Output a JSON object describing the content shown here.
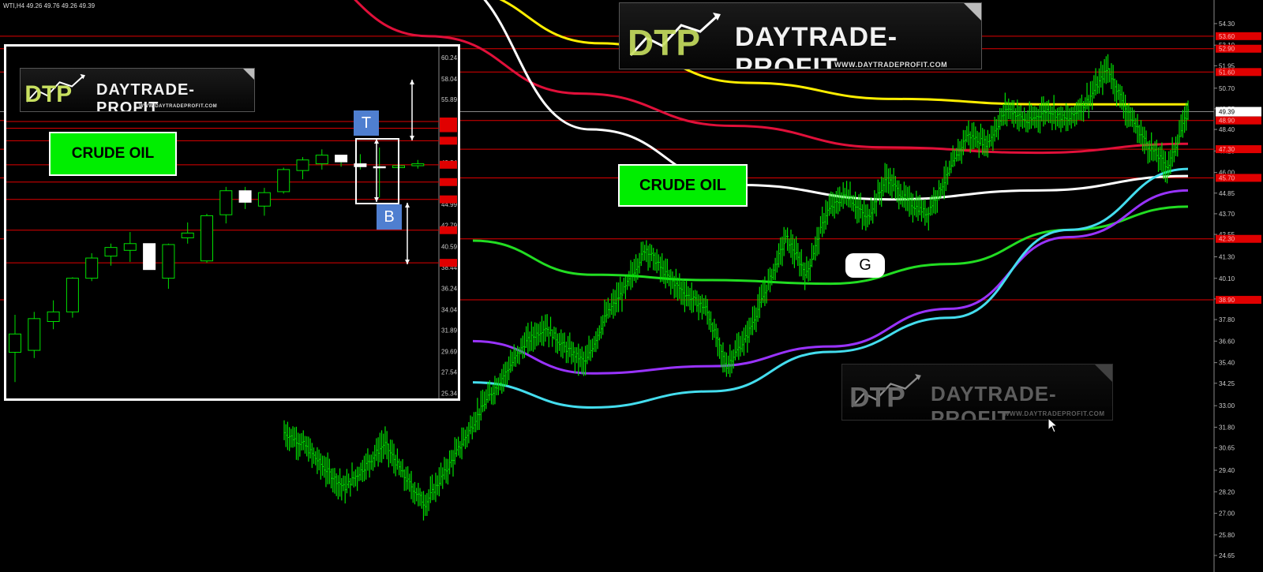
{
  "header": {
    "symbol_ohlc": "WTI,H4  49.26 49.76 49.26 49.39"
  },
  "brand": {
    "name": "DAYTRADE-PROFIT",
    "url": "WWW.DAYTRADEPROFIT.COM",
    "mark": "DTP"
  },
  "labels": {
    "crude_main": "CRUDE OIL",
    "crude_inset": "CRUDE OIL",
    "g": "G",
    "t": "T",
    "b": "B"
  },
  "colors": {
    "background": "#000000",
    "candles": "#00e000",
    "hlines": "#e00000",
    "ma_yellow": "#ffee00",
    "ma_red": "#e0103a",
    "ma_white": "#ffffff",
    "ma_green": "#22dd22",
    "ma_purple": "#9933ff",
    "ma_cyan": "#44ddee",
    "label_green": "#00ee00",
    "tb_blue": "#4f7fd0"
  },
  "chart_data": [
    {
      "type": "line",
      "instrument": "WTI",
      "timeframe": "H4",
      "y_ticks": [
        54.3,
        53.1,
        51.95,
        50.7,
        49.55,
        48.4,
        47.2,
        46.0,
        44.85,
        43.7,
        42.55,
        41.3,
        40.1,
        38.95,
        37.8,
        36.6,
        35.4,
        34.25,
        33.0,
        31.8,
        30.65,
        29.4,
        28.2,
        27.0,
        25.8,
        24.65
      ],
      "ylim": [
        24.3,
        55.0
      ],
      "current_price": 49.39,
      "hlines": [
        53.6,
        52.9,
        51.6,
        48.9,
        47.3,
        45.7,
        42.3,
        38.9
      ],
      "price_series": [
        31.5,
        30.8,
        29.5,
        28.4,
        29.6,
        30.9,
        29.0,
        27.5,
        29.3,
        31.2,
        33.2,
        34.8,
        36.5,
        37.4,
        36.2,
        35.4,
        38.0,
        39.6,
        41.8,
        40.3,
        39.2,
        38.4,
        35.2,
        36.8,
        39.5,
        42.4,
        40.3,
        43.8,
        44.8,
        43.4,
        45.7,
        44.4,
        43.7,
        45.8,
        48.1,
        47.6,
        49.6,
        48.8,
        49.5,
        48.9,
        50.0,
        51.8,
        49.3,
        47.5,
        46.3,
        49.39
      ],
      "moving_averages": [
        {
          "color": "#ffee00",
          "values": [
            56.2,
            53.2,
            51.0,
            50.1,
            49.8,
            49.8
          ]
        },
        {
          "color": "#e0103a",
          "values": [
            57.9,
            53.6,
            50.4,
            48.6,
            47.4,
            47.1,
            47.6
          ]
        },
        {
          "color": "#ffffff",
          "values": [
            56.9,
            48.4,
            45.3,
            44.5,
            45.0,
            45.8
          ]
        },
        {
          "color": "#22dd22",
          "values": [
            42.2,
            40.3,
            40.0,
            39.8,
            40.9,
            42.8,
            44.1
          ]
        },
        {
          "color": "#9933ff",
          "values": [
            36.6,
            34.8,
            35.2,
            36.3,
            38.4,
            42.4,
            45.0
          ]
        },
        {
          "color": "#44ddee",
          "values": [
            34.3,
            32.9,
            33.8,
            36.0,
            37.9,
            42.8,
            46.2
          ]
        }
      ]
    },
    {
      "type": "candlestick",
      "inset": true,
      "y_ticks": [
        60.24,
        58.04,
        55.89,
        53.69,
        51.54,
        49.34,
        47.14,
        44.99,
        42.79,
        40.59,
        38.44,
        36.24,
        34.04,
        31.89,
        29.69,
        27.54,
        25.34
      ],
      "ylim": [
        24.8,
        60.9
      ],
      "hlines": [
        53.6,
        52.9,
        51.6,
        49.1,
        47.3,
        45.5,
        42.3,
        38.9
      ],
      "candles": [
        {
          "o": 29.6,
          "h": 33.5,
          "l": 26.5,
          "c": 31.5
        },
        {
          "o": 29.8,
          "h": 33.8,
          "l": 29.0,
          "c": 33.1
        },
        {
          "o": 32.8,
          "h": 35.0,
          "l": 32.0,
          "c": 33.8
        },
        {
          "o": 33.8,
          "h": 37.4,
          "l": 33.2,
          "c": 37.3
        },
        {
          "o": 37.3,
          "h": 39.9,
          "l": 37.0,
          "c": 39.4
        },
        {
          "o": 39.6,
          "h": 40.9,
          "l": 38.6,
          "c": 40.5
        },
        {
          "o": 40.2,
          "h": 42.1,
          "l": 39.0,
          "c": 40.9
        },
        {
          "o": 40.9,
          "h": 40.6,
          "l": 38.2,
          "c": 38.2
        },
        {
          "o": 37.3,
          "h": 40.9,
          "l": 36.2,
          "c": 40.8
        },
        {
          "o": 41.5,
          "h": 43.1,
          "l": 40.9,
          "c": 42.0
        },
        {
          "o": 39.1,
          "h": 44.0,
          "l": 38.9,
          "c": 43.8
        },
        {
          "o": 43.9,
          "h": 46.8,
          "l": 43.0,
          "c": 46.4
        },
        {
          "o": 46.4,
          "h": 46.8,
          "l": 44.5,
          "c": 45.2
        },
        {
          "o": 44.8,
          "h": 46.7,
          "l": 43.8,
          "c": 46.2
        },
        {
          "o": 46.3,
          "h": 48.8,
          "l": 46.1,
          "c": 48.6
        },
        {
          "o": 48.5,
          "h": 49.9,
          "l": 47.6,
          "c": 49.6
        },
        {
          "o": 49.2,
          "h": 50.7,
          "l": 48.6,
          "c": 50.1
        },
        {
          "o": 50.1,
          "h": 50.1,
          "l": 48.9,
          "c": 49.4
        },
        {
          "o": 49.2,
          "h": 50.2,
          "l": 48.6,
          "c": 48.9
        },
        {
          "o": 48.9,
          "h": 50.9,
          "l": 45.7,
          "c": 48.8
        },
        {
          "o": 48.8,
          "h": 49.3,
          "l": 45.9,
          "c": 49.0
        },
        {
          "o": 49.0,
          "h": 49.6,
          "l": 48.7,
          "c": 49.2
        }
      ]
    }
  ]
}
